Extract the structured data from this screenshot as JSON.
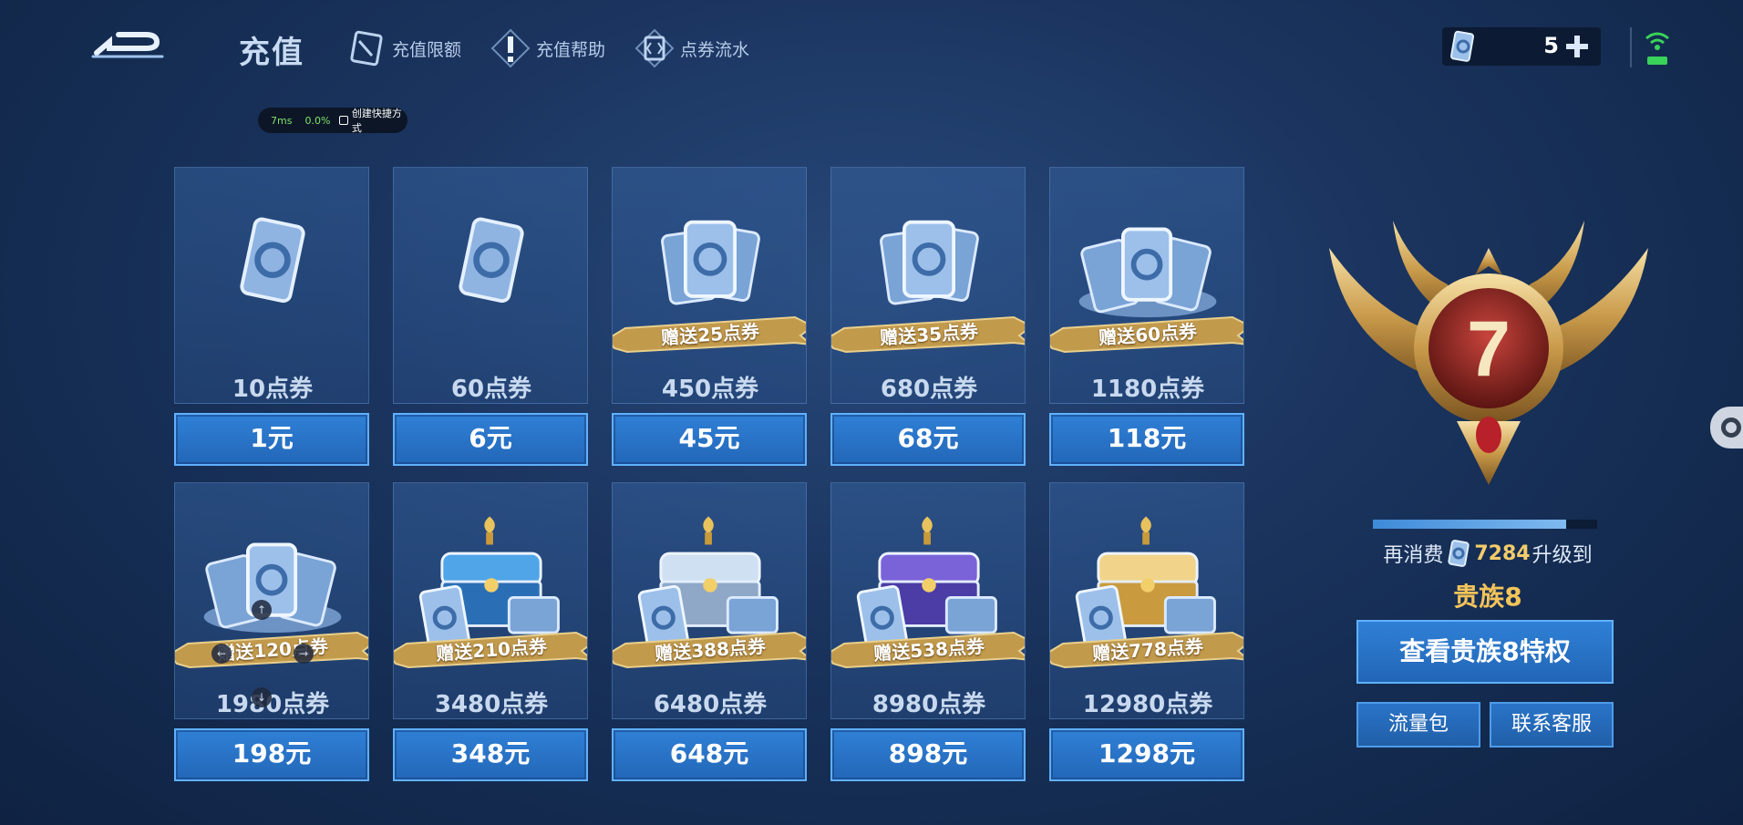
{
  "header": {
    "title": "充值",
    "nav": [
      {
        "label": "充值限额",
        "icon": "card-icon"
      },
      {
        "label": "充值帮助",
        "icon": "exclamation-icon"
      },
      {
        "label": "点券流水",
        "icon": "ledger-icon"
      }
    ]
  },
  "overlay": {
    "ms": "7ms",
    "pct": "0.0%",
    "shortcut": "创建快捷方式"
  },
  "currency": {
    "value": "5",
    "icon": "voucher-icon",
    "add_icon": "plus-icon"
  },
  "packages": [
    {
      "amount": "10点券",
      "price": "1元",
      "bonus": "",
      "art": "single-card"
    },
    {
      "amount": "60点券",
      "price": "6元",
      "bonus": "",
      "art": "single-card"
    },
    {
      "amount": "450点券",
      "price": "45元",
      "bonus": "赠送25点券",
      "art": "card-stack"
    },
    {
      "amount": "680点券",
      "price": "68元",
      "bonus": "赠送35点券",
      "art": "card-stack"
    },
    {
      "amount": "1180点券",
      "price": "118元",
      "bonus": "赠送60点券",
      "art": "card-pile"
    },
    {
      "amount": "1980点券",
      "price": "198元",
      "bonus": "赠送120点券",
      "art": "card-pile"
    },
    {
      "amount": "3480点券",
      "price": "348元",
      "bonus": "赠送210点券",
      "art": "blue-chest"
    },
    {
      "amount": "6480点券",
      "price": "648元",
      "bonus": "赠送388点券",
      "art": "silver-chest"
    },
    {
      "amount": "8980点券",
      "price": "898元",
      "bonus": "赠送538点券",
      "art": "purple-chest"
    },
    {
      "amount": "12980点券",
      "price": "1298元",
      "bonus": "赠送778点券",
      "art": "gold-chest"
    }
  ],
  "noble": {
    "level": "7",
    "progress_fraction": 0.86,
    "upgrade_prefix": "再消费",
    "upgrade_amount": "7284",
    "upgrade_suffix": "升级到",
    "next_rank": "贵族8",
    "view_button": "查看贵族8特权"
  },
  "footer_buttons": {
    "data_pack": "流量包",
    "support": "联系客服"
  },
  "colors": {
    "accent": "#2f80d6",
    "gold": "#f4c45a",
    "background": "#1b3560"
  }
}
